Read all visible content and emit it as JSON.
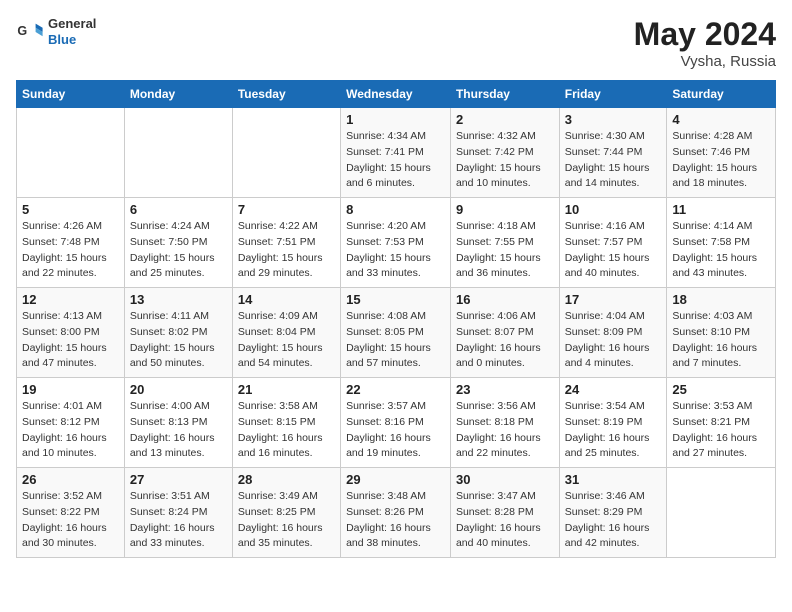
{
  "header": {
    "logo_general": "General",
    "logo_blue": "Blue",
    "month_year": "May 2024",
    "location": "Vysha, Russia"
  },
  "days_of_week": [
    "Sunday",
    "Monday",
    "Tuesday",
    "Wednesday",
    "Thursday",
    "Friday",
    "Saturday"
  ],
  "weeks": [
    [
      {
        "day": "",
        "info": ""
      },
      {
        "day": "",
        "info": ""
      },
      {
        "day": "",
        "info": ""
      },
      {
        "day": "1",
        "info": "Sunrise: 4:34 AM\nSunset: 7:41 PM\nDaylight: 15 hours\nand 6 minutes."
      },
      {
        "day": "2",
        "info": "Sunrise: 4:32 AM\nSunset: 7:42 PM\nDaylight: 15 hours\nand 10 minutes."
      },
      {
        "day": "3",
        "info": "Sunrise: 4:30 AM\nSunset: 7:44 PM\nDaylight: 15 hours\nand 14 minutes."
      },
      {
        "day": "4",
        "info": "Sunrise: 4:28 AM\nSunset: 7:46 PM\nDaylight: 15 hours\nand 18 minutes."
      }
    ],
    [
      {
        "day": "5",
        "info": "Sunrise: 4:26 AM\nSunset: 7:48 PM\nDaylight: 15 hours\nand 22 minutes."
      },
      {
        "day": "6",
        "info": "Sunrise: 4:24 AM\nSunset: 7:50 PM\nDaylight: 15 hours\nand 25 minutes."
      },
      {
        "day": "7",
        "info": "Sunrise: 4:22 AM\nSunset: 7:51 PM\nDaylight: 15 hours\nand 29 minutes."
      },
      {
        "day": "8",
        "info": "Sunrise: 4:20 AM\nSunset: 7:53 PM\nDaylight: 15 hours\nand 33 minutes."
      },
      {
        "day": "9",
        "info": "Sunrise: 4:18 AM\nSunset: 7:55 PM\nDaylight: 15 hours\nand 36 minutes."
      },
      {
        "day": "10",
        "info": "Sunrise: 4:16 AM\nSunset: 7:57 PM\nDaylight: 15 hours\nand 40 minutes."
      },
      {
        "day": "11",
        "info": "Sunrise: 4:14 AM\nSunset: 7:58 PM\nDaylight: 15 hours\nand 43 minutes."
      }
    ],
    [
      {
        "day": "12",
        "info": "Sunrise: 4:13 AM\nSunset: 8:00 PM\nDaylight: 15 hours\nand 47 minutes."
      },
      {
        "day": "13",
        "info": "Sunrise: 4:11 AM\nSunset: 8:02 PM\nDaylight: 15 hours\nand 50 minutes."
      },
      {
        "day": "14",
        "info": "Sunrise: 4:09 AM\nSunset: 8:04 PM\nDaylight: 15 hours\nand 54 minutes."
      },
      {
        "day": "15",
        "info": "Sunrise: 4:08 AM\nSunset: 8:05 PM\nDaylight: 15 hours\nand 57 minutes."
      },
      {
        "day": "16",
        "info": "Sunrise: 4:06 AM\nSunset: 8:07 PM\nDaylight: 16 hours\nand 0 minutes."
      },
      {
        "day": "17",
        "info": "Sunrise: 4:04 AM\nSunset: 8:09 PM\nDaylight: 16 hours\nand 4 minutes."
      },
      {
        "day": "18",
        "info": "Sunrise: 4:03 AM\nSunset: 8:10 PM\nDaylight: 16 hours\nand 7 minutes."
      }
    ],
    [
      {
        "day": "19",
        "info": "Sunrise: 4:01 AM\nSunset: 8:12 PM\nDaylight: 16 hours\nand 10 minutes."
      },
      {
        "day": "20",
        "info": "Sunrise: 4:00 AM\nSunset: 8:13 PM\nDaylight: 16 hours\nand 13 minutes."
      },
      {
        "day": "21",
        "info": "Sunrise: 3:58 AM\nSunset: 8:15 PM\nDaylight: 16 hours\nand 16 minutes."
      },
      {
        "day": "22",
        "info": "Sunrise: 3:57 AM\nSunset: 8:16 PM\nDaylight: 16 hours\nand 19 minutes."
      },
      {
        "day": "23",
        "info": "Sunrise: 3:56 AM\nSunset: 8:18 PM\nDaylight: 16 hours\nand 22 minutes."
      },
      {
        "day": "24",
        "info": "Sunrise: 3:54 AM\nSunset: 8:19 PM\nDaylight: 16 hours\nand 25 minutes."
      },
      {
        "day": "25",
        "info": "Sunrise: 3:53 AM\nSunset: 8:21 PM\nDaylight: 16 hours\nand 27 minutes."
      }
    ],
    [
      {
        "day": "26",
        "info": "Sunrise: 3:52 AM\nSunset: 8:22 PM\nDaylight: 16 hours\nand 30 minutes."
      },
      {
        "day": "27",
        "info": "Sunrise: 3:51 AM\nSunset: 8:24 PM\nDaylight: 16 hours\nand 33 minutes."
      },
      {
        "day": "28",
        "info": "Sunrise: 3:49 AM\nSunset: 8:25 PM\nDaylight: 16 hours\nand 35 minutes."
      },
      {
        "day": "29",
        "info": "Sunrise: 3:48 AM\nSunset: 8:26 PM\nDaylight: 16 hours\nand 38 minutes."
      },
      {
        "day": "30",
        "info": "Sunrise: 3:47 AM\nSunset: 8:28 PM\nDaylight: 16 hours\nand 40 minutes."
      },
      {
        "day": "31",
        "info": "Sunrise: 3:46 AM\nSunset: 8:29 PM\nDaylight: 16 hours\nand 42 minutes."
      },
      {
        "day": "",
        "info": ""
      }
    ]
  ]
}
